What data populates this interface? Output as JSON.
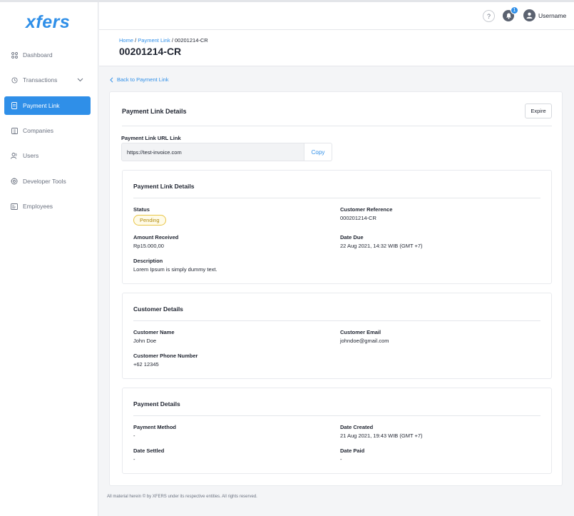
{
  "brand": {
    "logo_text": "xfers"
  },
  "sidebar": {
    "items": [
      {
        "label": "Dashboard",
        "icon": "grid-icon"
      },
      {
        "label": "Transactions",
        "icon": "history-icon",
        "expandable": true
      },
      {
        "label": "Payment Link",
        "icon": "document-icon",
        "active": true
      },
      {
        "label": "Companies",
        "icon": "building-icon"
      },
      {
        "label": "Users",
        "icon": "users-icon"
      },
      {
        "label": "Developer Tools",
        "icon": "gear-icon"
      },
      {
        "label": "Employees",
        "icon": "id-card-icon"
      }
    ]
  },
  "topbar": {
    "help_label": "?",
    "notification_count": "1",
    "username": "Username"
  },
  "header": {
    "breadcrumb": {
      "home": "Home",
      "sep": " / ",
      "parent": "Payment Link",
      "current": "00201214-CR"
    },
    "title": "00201214-CR"
  },
  "back_link": "Back to Payment Link",
  "card": {
    "title": "Payment Link Details",
    "expire_label": "Expire",
    "url_label": "Payment Link URL Link",
    "url_value": "https://test-invoice.com",
    "copy_label": "Copy"
  },
  "link_details": {
    "title": "Payment Link Details",
    "status_label": "Status",
    "status_value": "Pending",
    "customer_reference_label": "Customer Reference",
    "customer_reference_value": "000201214-CR",
    "amount_received_label": "Amount Received",
    "amount_received_value": "Rp15.000,00",
    "date_due_label": "Date Due",
    "date_due_value": "22 Aug 2021, 14:32 WIB (GMT +7)",
    "description_label": "Description",
    "description_value": "Lorem Ipsum is simply dummy text."
  },
  "customer_details": {
    "title": "Customer Details",
    "name_label": "Customer Name",
    "name_value": "John Doe",
    "email_label": "Customer Email",
    "email_value": "johndoe@gmail.com",
    "phone_label": "Customer Phone Number",
    "phone_value": "+62 12345"
  },
  "payment_details": {
    "title": "Payment Details",
    "method_label": "Payment Method",
    "method_value": "-",
    "date_created_label": "Date Created",
    "date_created_value": "21 Aug 2021, 19:43 WIB (GMT +7)",
    "date_settled_label": "Date Settled",
    "date_settled_value": "-",
    "date_paid_label": "Date Paid",
    "date_paid_value": "-"
  },
  "footer": {
    "text": "All material herein © by XFERS under its respective entities. All rights reserved."
  },
  "colors": {
    "accent": "#2f8fe8",
    "pending_border": "#e8c547",
    "pending_text": "#b08a0c"
  }
}
